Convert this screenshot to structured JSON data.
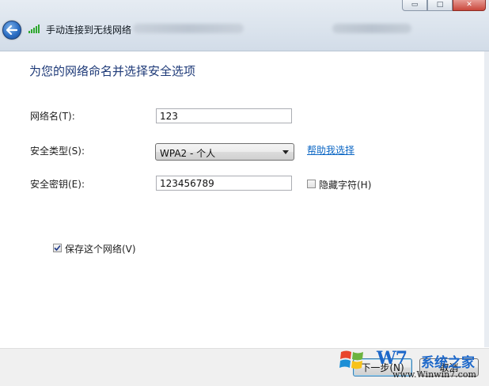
{
  "window": {
    "title": "手动连接到无线网络",
    "controls": {
      "minimize": "▭",
      "maximize": "□",
      "close": "✕"
    }
  },
  "page": {
    "heading": "为您的网络命名并选择安全选项"
  },
  "form": {
    "network_name": {
      "label": "网络名(T):",
      "value": "123"
    },
    "security_type": {
      "label": "安全类型(S):",
      "value": "WPA2 - 个人",
      "help_link": "帮助我选择"
    },
    "security_key": {
      "label": "安全密钥(E):",
      "value": "123456789"
    },
    "hide_chars": {
      "label": "隐藏字符(H)",
      "checked": false
    },
    "save_network": {
      "label": "保存这个网络(V)",
      "checked": true
    }
  },
  "footer": {
    "next_label": "下一步(N)",
    "cancel_label": "取消"
  },
  "watermark": {
    "brand": "W7",
    "name": "系统之家",
    "url": "www.Winwin7.com"
  },
  "icons": [
    "back-arrow-icon",
    "wifi-signal-icon",
    "dropdown-arrow-icon",
    "checkmark-icon",
    "windows-logo-icon"
  ],
  "colors": {
    "heading": "#1e3a78",
    "link": "#0b66c4",
    "back_button": "#2d6fc4",
    "watermark": "#1c67c9"
  }
}
